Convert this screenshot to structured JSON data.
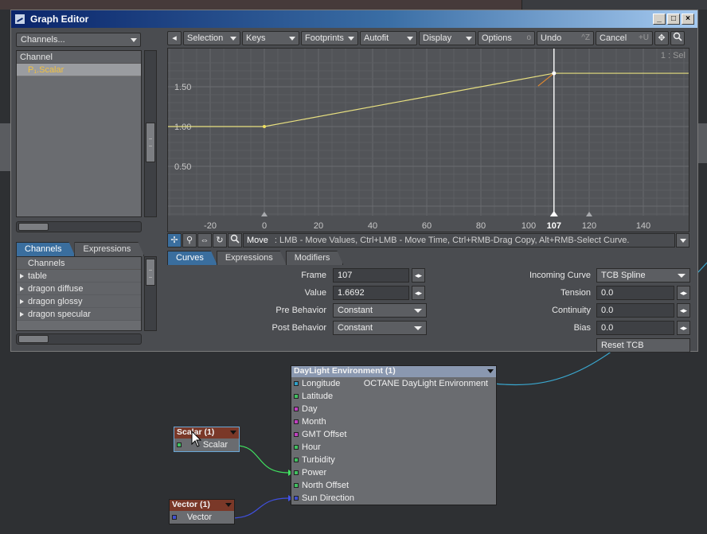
{
  "window": {
    "title": "Graph Editor",
    "buttons": {
      "minimize": "_",
      "maximize": "□",
      "close": "×"
    }
  },
  "left_panel": {
    "channels_dropdown": "Channels...",
    "channel_list_header": "Channel",
    "channel_items": [
      "P₁.Scalar"
    ],
    "tabs": [
      "Channels",
      "Expressions"
    ],
    "tree_header": "Channels",
    "tree_items": [
      "table",
      "dragon diffuse",
      "dragon glossy",
      "dragon specular"
    ]
  },
  "toolbar": {
    "nav_left": "◂",
    "selection": "Selection",
    "keys": "Keys",
    "footprints": "Footprints",
    "autofit": "Autofit",
    "display": "Display",
    "options": "Options",
    "options_hint": "o",
    "undo": "Undo",
    "undo_hint": "^Z",
    "cancel": "Cancel",
    "cancel_hint": "+U",
    "move_icon": "✥",
    "zoom_icon": "🔍"
  },
  "graph": {
    "corner_label": "1 : Sel",
    "y_ticks": [
      "1.50",
      "1.00",
      "0.50"
    ],
    "x_ticks": [
      "-20",
      "0",
      "20",
      "40",
      "60",
      "80",
      "100",
      "107",
      "120",
      "140"
    ],
    "current_frame": 107,
    "curve_points": [
      {
        "frame": -40,
        "value": 1.0
      },
      {
        "frame": 0,
        "value": 1.0
      },
      {
        "frame": 107,
        "value": 1.6692
      },
      {
        "frame": 160,
        "value": 1.6692
      }
    ]
  },
  "status": {
    "mode": "Move",
    "help": ": LMB - Move Values, Ctrl+LMB - Move Time, Ctrl+RMB-Drag Copy, Alt+RMB-Select Curve."
  },
  "bottom_tabs": [
    "Curves",
    "Expressions",
    "Modifiers"
  ],
  "key_props": {
    "frame_label": "Frame",
    "frame_value": "107",
    "value_label": "Value",
    "value_value": "1.6692",
    "pre_behavior_label": "Pre Behavior",
    "pre_behavior_value": "Constant",
    "post_behavior_label": "Post Behavior",
    "post_behavior_value": "Constant",
    "incoming_curve_label": "Incoming Curve",
    "incoming_curve_value": "TCB Spline",
    "tension_label": "Tension",
    "tension_value": "0.0",
    "continuity_label": "Continuity",
    "continuity_value": "0.0",
    "bias_label": "Bias",
    "bias_value": "0.0",
    "reset_tcb": "Reset TCB"
  },
  "nodes": {
    "daylight": {
      "title": "DayLight Environment (1)",
      "output": "OCTANE DayLight Environment",
      "inputs": [
        {
          "label": "Longitude",
          "color": "#40c060"
        },
        {
          "label": "Latitude",
          "color": "#40c060"
        },
        {
          "label": "Day",
          "color": "#c040c0"
        },
        {
          "label": "Month",
          "color": "#c040c0"
        },
        {
          "label": "GMT Offset",
          "color": "#c040c0"
        },
        {
          "label": "Hour",
          "color": "#40c060"
        },
        {
          "label": "Turbidity",
          "color": "#40c060"
        },
        {
          "label": "Power",
          "color": "#40c060"
        },
        {
          "label": "North Offset",
          "color": "#40c060"
        },
        {
          "label": "Sun Direction",
          "color": "#4050d0"
        }
      ]
    },
    "scalar": {
      "title": "Scalar (1)",
      "output": "Scalar"
    },
    "vector": {
      "title": "Vector (1)",
      "output": "Vector"
    }
  }
}
